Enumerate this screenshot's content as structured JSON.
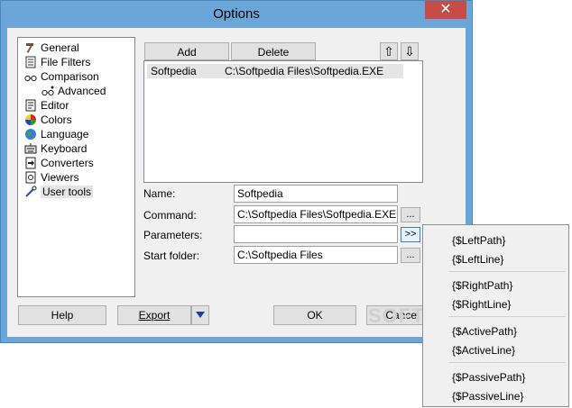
{
  "window": {
    "title": "Options",
    "close_glyph": "✕"
  },
  "tree": {
    "items": [
      {
        "label": "General",
        "icon": "hammer-icon"
      },
      {
        "label": "File Filters",
        "icon": "filter-icon"
      },
      {
        "label": "Comparison",
        "icon": "glasses-icon"
      },
      {
        "label": "Advanced",
        "icon": "glasses-advanced-icon"
      },
      {
        "label": "Editor",
        "icon": "document-icon"
      },
      {
        "label": "Colors",
        "icon": "color-wheel-icon"
      },
      {
        "label": "Language",
        "icon": "globe-icon"
      },
      {
        "label": "Keyboard",
        "icon": "keyboard-icon"
      },
      {
        "label": "Converters",
        "icon": "converter-icon"
      },
      {
        "label": "Viewers",
        "icon": "viewer-icon"
      },
      {
        "label": "User tools",
        "icon": "tools-icon"
      }
    ],
    "selected": "User tools"
  },
  "toolbar": {
    "add_label": "Add",
    "delete_label": "Delete",
    "up_glyph": "⇧",
    "down_glyph": "⇩"
  },
  "list": {
    "rows": [
      {
        "name": "Softpedia",
        "path": "C:\\Softpedia Files\\Softpedia.EXE"
      }
    ]
  },
  "form": {
    "name_label": "Name:",
    "name_value": "Softpedia",
    "command_label": "Command:",
    "command_value": "C:\\Softpedia Files\\Softpedia.EXE",
    "parameters_label": "Parameters:",
    "parameters_value": "",
    "start_folder_label": "Start folder:",
    "start_folder_value": "C:\\Softpedia Files",
    "browse_label": "...",
    "params_menu_label": ">>"
  },
  "footer": {
    "help_label": "Help",
    "export_label": "Export",
    "ok_label": "OK",
    "cancel_label": "Cancel"
  },
  "popup": {
    "groups": [
      [
        "{$LeftPath}",
        "{$LeftLine}"
      ],
      [
        "{$RightPath}",
        "{$RightLine}"
      ],
      [
        "{$ActivePath}",
        "{$ActiveLine}"
      ],
      [
        "{$PassivePath}",
        "{$PassiveLine}"
      ]
    ]
  },
  "watermark": "SOFTPEDIA"
}
